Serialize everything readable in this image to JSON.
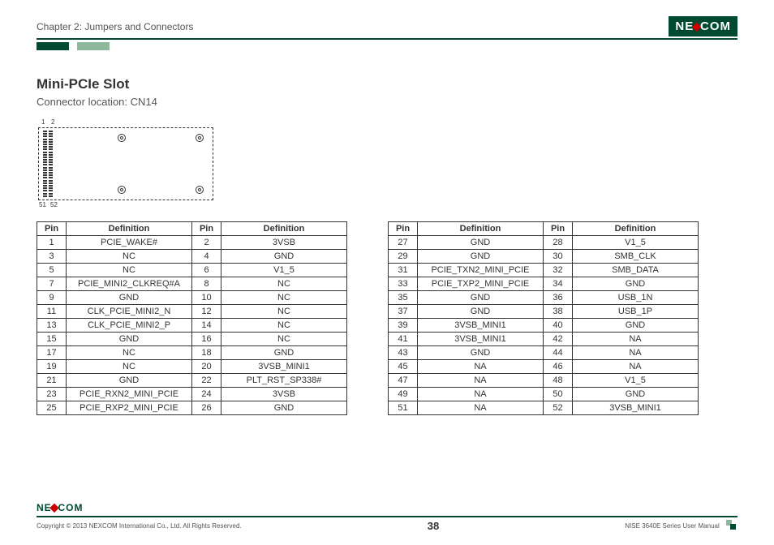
{
  "header": {
    "chapter": "Chapter 2: Jumpers and Connectors",
    "logo_text_left": "NE",
    "logo_text_right": "COM"
  },
  "section": {
    "title": "Mini-PCIe Slot",
    "subtitle": "Connector location: CN14"
  },
  "diagram_labels": {
    "p1": "1",
    "p2": "2",
    "p51": "51",
    "p52": "52"
  },
  "table_headers": {
    "pin": "Pin",
    "def": "Definition"
  },
  "table_left": [
    {
      "a": "1",
      "ad": "PCIE_WAKE#",
      "b": "2",
      "bd": "3VSB"
    },
    {
      "a": "3",
      "ad": "NC",
      "b": "4",
      "bd": "GND"
    },
    {
      "a": "5",
      "ad": "NC",
      "b": "6",
      "bd": "V1_5"
    },
    {
      "a": "7",
      "ad": "PCIE_MINI2_CLKREQ#A",
      "b": "8",
      "bd": "NC"
    },
    {
      "a": "9",
      "ad": "GND",
      "b": "10",
      "bd": "NC"
    },
    {
      "a": "11",
      "ad": "CLK_PCIE_MINI2_N",
      "b": "12",
      "bd": "NC"
    },
    {
      "a": "13",
      "ad": "CLK_PCIE_MINI2_P",
      "b": "14",
      "bd": "NC"
    },
    {
      "a": "15",
      "ad": "GND",
      "b": "16",
      "bd": "NC"
    },
    {
      "a": "17",
      "ad": "NC",
      "b": "18",
      "bd": "GND"
    },
    {
      "a": "19",
      "ad": "NC",
      "b": "20",
      "bd": "3VSB_MINI1"
    },
    {
      "a": "21",
      "ad": "GND",
      "b": "22",
      "bd": "PLT_RST_SP338#"
    },
    {
      "a": "23",
      "ad": "PCIE_RXN2_MINI_PCIE",
      "b": "24",
      "bd": "3VSB"
    },
    {
      "a": "25",
      "ad": "PCIE_RXP2_MINI_PCIE",
      "b": "26",
      "bd": "GND"
    }
  ],
  "table_right": [
    {
      "a": "27",
      "ad": "GND",
      "b": "28",
      "bd": "V1_5"
    },
    {
      "a": "29",
      "ad": "GND",
      "b": "30",
      "bd": "SMB_CLK"
    },
    {
      "a": "31",
      "ad": "PCIE_TXN2_MINI_PCIE",
      "b": "32",
      "bd": "SMB_DATA"
    },
    {
      "a": "33",
      "ad": "PCIE_TXP2_MINI_PCIE",
      "b": "34",
      "bd": "GND"
    },
    {
      "a": "35",
      "ad": "GND",
      "b": "36",
      "bd": "USB_1N"
    },
    {
      "a": "37",
      "ad": "GND",
      "b": "38",
      "bd": "USB_1P"
    },
    {
      "a": "39",
      "ad": "3VSB_MINI1",
      "b": "40",
      "bd": "GND"
    },
    {
      "a": "41",
      "ad": "3VSB_MINI1",
      "b": "42",
      "bd": "NA"
    },
    {
      "a": "43",
      "ad": "GND",
      "b": "44",
      "bd": "NA"
    },
    {
      "a": "45",
      "ad": "NA",
      "b": "46",
      "bd": "NA"
    },
    {
      "a": "47",
      "ad": "NA",
      "b": "48",
      "bd": "V1_5"
    },
    {
      "a": "49",
      "ad": "NA",
      "b": "50",
      "bd": "GND"
    },
    {
      "a": "51",
      "ad": "NA",
      "b": "52",
      "bd": "3VSB_MINI1"
    }
  ],
  "footer": {
    "copyright": "Copyright © 2013 NEXCOM International Co., Ltd. All Rights Reserved.",
    "page": "38",
    "manual": "NISE 3640E Series User Manual"
  }
}
